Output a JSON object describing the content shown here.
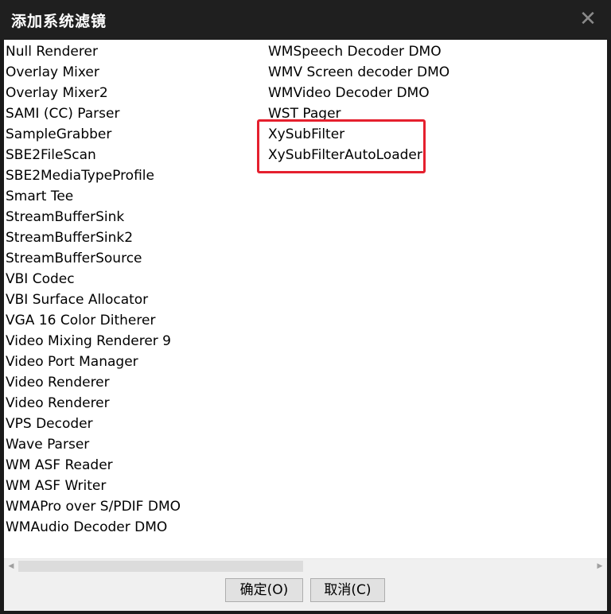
{
  "window": {
    "title": "添加系统滤镜",
    "close_glyph": "✕"
  },
  "filters": {
    "column_1": [
      "Null Renderer",
      "Overlay Mixer",
      "Overlay Mixer2",
      "SAMI (CC) Parser",
      "SampleGrabber",
      "SBE2FileScan",
      "SBE2MediaTypeProfile",
      "Smart Tee",
      "StreamBufferSink",
      "StreamBufferSink2",
      "StreamBufferSource",
      "VBI Codec",
      "VBI Surface Allocator",
      "VGA 16 Color Ditherer",
      "Video Mixing Renderer 9",
      "Video Port Manager",
      "Video Renderer",
      "Video Renderer",
      "VPS Decoder",
      "Wave Parser",
      "WM ASF Reader",
      "WM ASF Writer",
      "WMAPro over S/PDIF DMO",
      "WMAudio Decoder DMO"
    ],
    "column_2": [
      "WMSpeech Decoder DMO",
      "WMV Screen decoder DMO",
      "WMVideo Decoder DMO",
      "WST Pager",
      "XySubFilter",
      "XySubFilterAutoLoader"
    ]
  },
  "scrollbar": {
    "left_arrow": "◀",
    "right_arrow": "▶"
  },
  "buttons": {
    "ok_label": "确定(O)",
    "cancel_label": "取消(C)"
  },
  "colors": {
    "highlight_border": "#e5202e"
  }
}
